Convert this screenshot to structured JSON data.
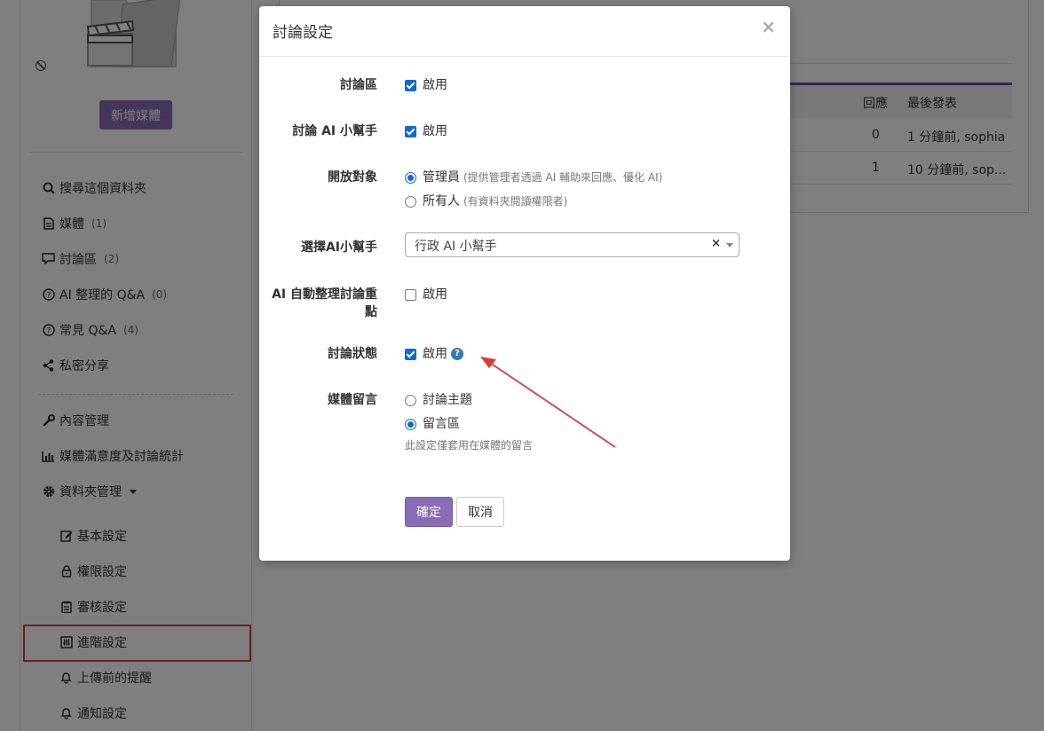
{
  "sidebar": {
    "add_media_label": "新增媒體",
    "items": [
      {
        "icon": "search-icon",
        "label": "搜尋這個資料夾",
        "count": ""
      },
      {
        "icon": "file-icon",
        "label": "媒體",
        "count": "(1)"
      },
      {
        "icon": "comment-icon",
        "label": "討論區",
        "count": "(2)"
      },
      {
        "icon": "question-circle-icon",
        "label": "AI 整理的 Q&A",
        "count": "(0)"
      },
      {
        "icon": "question-circle-icon",
        "label": "常見 Q&A",
        "count": "(4)"
      },
      {
        "icon": "share-icon",
        "label": "私密分享",
        "count": ""
      },
      {
        "icon": "wrench-icon",
        "label": "內容管理",
        "count": ""
      },
      {
        "icon": "bar-chart-icon",
        "label": "媒體滿意度及討論統計",
        "count": ""
      },
      {
        "icon": "gear-icon",
        "label": "資料夾管理",
        "count": ""
      }
    ],
    "sub_items": [
      {
        "icon": "edit-icon",
        "label": "基本設定"
      },
      {
        "icon": "lock-icon",
        "label": "權限設定"
      },
      {
        "icon": "clipboard-icon",
        "label": "審核設定"
      },
      {
        "icon": "sliders-icon",
        "label": "進階設定"
      },
      {
        "icon": "bell-icon",
        "label": "上傳前的提醒"
      },
      {
        "icon": "bell-icon",
        "label": "通知設定"
      }
    ]
  },
  "table": {
    "headers": [
      "回應",
      "最後發表"
    ],
    "rows": [
      {
        "replies": "0",
        "last": "1 分鐘前, sophia"
      },
      {
        "replies": "1",
        "last": "10 分鐘前, sop..."
      }
    ]
  },
  "modal": {
    "title": "討論設定",
    "close": "×",
    "fields": {
      "discussion": {
        "label": "討論區",
        "option": "啟用",
        "checked": true
      },
      "ai_assistant": {
        "label": "討論 AI 小幫手",
        "option": "啟用",
        "checked": true
      },
      "audience": {
        "label": "開放對象",
        "options": [
          {
            "label": "管理員",
            "hint": "(提供管理者透過 AI 輔助來回應、優化 AI)",
            "selected": true
          },
          {
            "label": "所有人",
            "hint": "(有資料夾閱讀權限者)",
            "selected": false
          }
        ]
      },
      "choose_assistant": {
        "label": "選擇AI小幫手",
        "value": "行政 AI 小幫手",
        "clear": "×"
      },
      "ai_summary": {
        "label_line1": "AI 自動整理討論重",
        "label_line2": "點",
        "option": "啟用",
        "checked": false
      },
      "discussion_status": {
        "label": "討論狀態",
        "option": "啟用",
        "checked": true,
        "help": "?"
      },
      "media_comment": {
        "label": "媒體留言",
        "options": [
          {
            "label": "討論主題",
            "selected": false
          },
          {
            "label": "留言區",
            "selected": true
          }
        ],
        "note": "此設定僅套用在媒體的留言"
      }
    },
    "ok_label": "確定",
    "cancel_label": "取消"
  },
  "colors": {
    "accent": "#8a6bb5",
    "checkbox": "#0f6ad8",
    "annotation": "#e03a3a"
  }
}
